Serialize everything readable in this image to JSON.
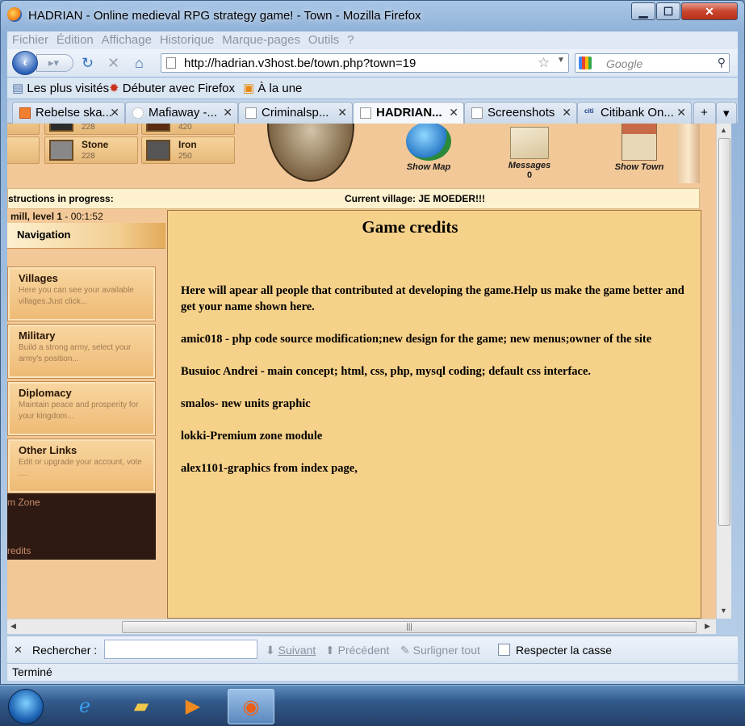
{
  "window": {
    "title": "HADRIAN - Online medieval RPG strategy game! - Town - Mozilla Firefox",
    "min_glyph": "▁",
    "max_glyph": "☐",
    "close_glyph": "✕"
  },
  "menu": [
    "Fichier",
    "Édition",
    "Affichage",
    "Historique",
    "Marque-pages",
    "Outils",
    "?"
  ],
  "nav": {
    "url": "http://hadrian.v3host.be/town.php?town=19",
    "search_placeholder": "Google"
  },
  "bookmarks": [
    {
      "label": "Les plus visités",
      "icon": "bookmark-icon"
    },
    {
      "label": "Débuter avec Firefox",
      "icon": "firefox-icon"
    },
    {
      "label": "À la une",
      "icon": "rss-icon"
    }
  ],
  "tabs": [
    {
      "label": "Rebelse ska...",
      "active": false
    },
    {
      "label": "Mafiaway -...",
      "active": false
    },
    {
      "label": "Criminalsp...",
      "active": false
    },
    {
      "label": "HADRIAN...",
      "active": true
    },
    {
      "label": "Screenshots",
      "active": false
    },
    {
      "label": "Citibank On...",
      "active": false
    }
  ],
  "resources": [
    {
      "name": "",
      "value": "228"
    },
    {
      "name": "",
      "value": "420"
    },
    {
      "name": "Stone",
      "value": "228"
    },
    {
      "name": "Iron",
      "value": "250"
    }
  ],
  "header_icons": {
    "map": "Show Map",
    "messages": "Messages",
    "messages_count": "0",
    "town": "Show Town"
  },
  "infobar": {
    "constructions": "structions in progress:",
    "village": "Current village: JE MOEDER!!!"
  },
  "construction": {
    "item": "mill, level 1",
    "time": "- 00:1:52"
  },
  "sidebar": {
    "heading": "Navigation",
    "items": [
      {
        "title": "Villages",
        "desc": "Here you can see your available villages.Just click..."
      },
      {
        "title": "Military",
        "desc": "Build a strong army, select your army's position..."
      },
      {
        "title": "Diplomacy",
        "desc": "Maintain peace and prosperity for your kingdom..."
      },
      {
        "title": "Other Links",
        "desc": "Edit or upgrade your account, vote ...."
      }
    ],
    "links": [
      "m Zone",
      "redits"
    ]
  },
  "content": {
    "title": "Game credits",
    "intro": "Here will apear all people that contributed at developing the game.Help us make the game better and get your name shown here.",
    "credits": [
      "amic018 - php code source modification;new design for the game; new menus;owner of the site",
      "Busuioc Andrei - main concept; html, css, php, mysql coding; default css interface.",
      "smalos- new units graphic",
      "lokki-Premium zone module",
      "alex1101-graphics from index page,"
    ]
  },
  "findbar": {
    "label": "Rechercher :",
    "next": "Suivant",
    "prev": "Précédent",
    "highlight": "Surligner tout",
    "match_case": "Respecter la casse"
  },
  "status": "Terminé",
  "taskbar": [
    "start-button",
    "internet-explorer",
    "file-explorer",
    "media-player",
    "firefox"
  ]
}
